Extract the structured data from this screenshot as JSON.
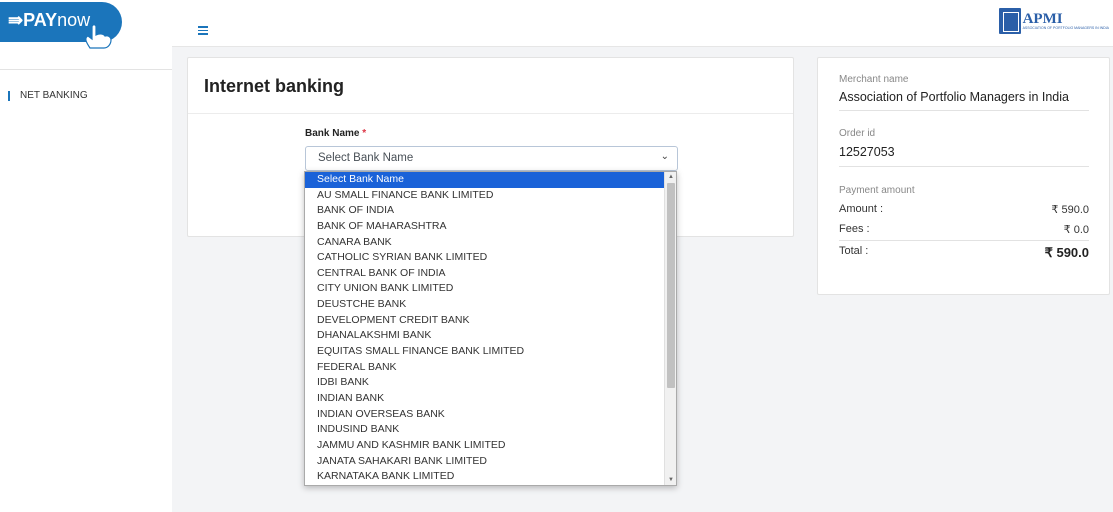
{
  "brand": {
    "logo_pay": "PAY",
    "logo_now": "now",
    "partner_title": "APMI",
    "partner_sub": "ASSOCIATION OF PORTFOLIO MANAGERS IN INDIA"
  },
  "sidebar": {
    "items": [
      {
        "label": "NET BANKING"
      }
    ]
  },
  "main": {
    "title": "Internet banking",
    "bank_label": "Bank Name",
    "required_mark": "*",
    "select_placeholder": "Select Bank Name",
    "options": [
      "Select Bank Name",
      "AU SMALL FINANCE BANK LIMITED",
      "BANK OF INDIA",
      "BANK OF MAHARASHTRA",
      "CANARA BANK",
      "CATHOLIC SYRIAN BANK LIMITED",
      "CENTRAL BANK OF INDIA",
      "CITY UNION BANK LIMITED",
      "DEUSTCHE BANK",
      "DEVELOPMENT CREDIT BANK",
      "DHANALAKSHMI BANK",
      "EQUITAS SMALL FINANCE BANK LIMITED",
      "FEDERAL BANK",
      "IDBI BANK",
      "INDIAN BANK",
      "INDIAN OVERSEAS BANK",
      "INDUSIND BANK",
      "JAMMU AND KASHMIR BANK LIMITED",
      "JANATA SAHAKARI BANK LIMITED",
      "KARNATAKA BANK LIMITED"
    ],
    "selected_index": 0
  },
  "summary": {
    "merchant_label": "Merchant name",
    "merchant_value": "Association of Portfolio Managers in India",
    "order_label": "Order id",
    "order_value": "12527053",
    "payment_label": "Payment amount",
    "amount_label": "Amount :",
    "amount_value": "₹ 590.0",
    "fees_label": "Fees :",
    "fees_value": "₹ 0.0",
    "total_label": "Total :",
    "total_value": "₹ 590.0"
  },
  "colors": {
    "accent": "#1b75bb",
    "selected": "#1a62d8",
    "required": "#dc3545"
  }
}
